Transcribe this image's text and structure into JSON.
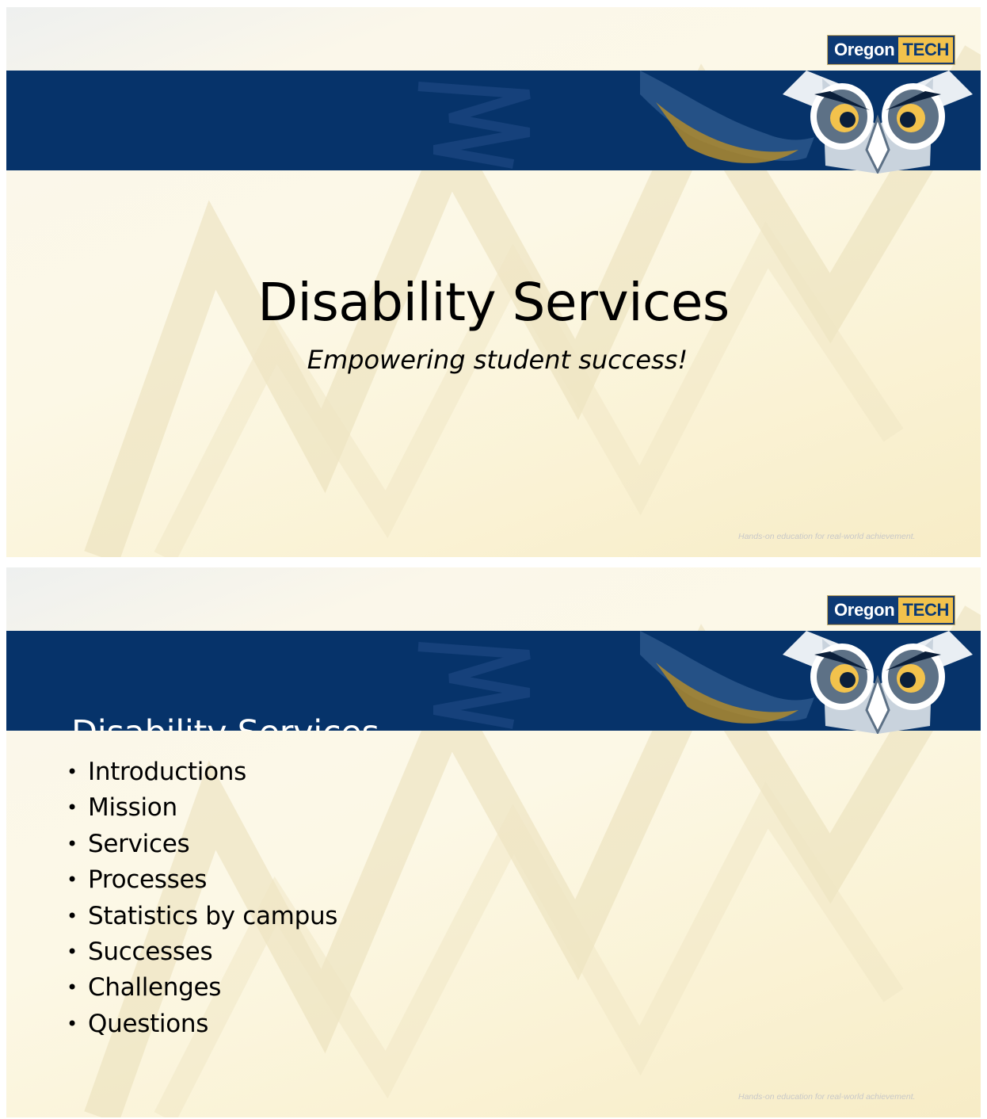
{
  "brand": {
    "logo_left": "Oregon",
    "logo_right": "TECH",
    "tagline": "Hands-on education for real-world achievement.",
    "banner_color": "#06336a",
    "gold_color": "#f2c24c",
    "mascot_icon": "owl-icon"
  },
  "slide1": {
    "title": "Disability Services",
    "subtitle": "Empowering student success!"
  },
  "slide2": {
    "title": "Disability Services",
    "bullet_glyph": "•",
    "items": [
      "Introductions",
      "Mission",
      "Services",
      "Processes",
      "Statistics by campus",
      "Successes",
      "Challenges",
      "Questions"
    ]
  }
}
